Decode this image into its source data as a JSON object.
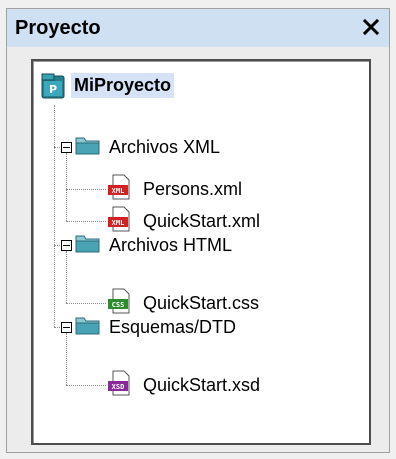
{
  "panel": {
    "title": "Proyecto",
    "close_icon": "close-icon"
  },
  "tree": {
    "root": {
      "label": "MiProyecto",
      "icon": "project-icon"
    },
    "folders": [
      {
        "label": "Archivos XML",
        "icon": "folder-icon",
        "expanded": true,
        "files": [
          {
            "label": "Persons.xml",
            "icon": "xml-file-icon",
            "badge": "XML",
            "color": "#d42020"
          },
          {
            "label": "QuickStart.xml",
            "icon": "xml-file-icon",
            "badge": "XML",
            "color": "#d42020"
          }
        ]
      },
      {
        "label": "Archivos HTML",
        "icon": "folder-icon",
        "expanded": true,
        "files": [
          {
            "label": "QuickStart.css",
            "icon": "css-file-icon",
            "badge": "CSS",
            "color": "#2e8b2e"
          }
        ]
      },
      {
        "label": "Esquemas/DTD",
        "icon": "folder-icon",
        "expanded": true,
        "files": [
          {
            "label": "QuickStart.xsd",
            "icon": "xsd-file-icon",
            "badge": "XSD",
            "color": "#8a2a9a"
          }
        ]
      }
    ]
  },
  "colors": {
    "titlebar": "#cfe0f3",
    "selection": "#d6e3f6",
    "folder": "#4aa3b5"
  }
}
